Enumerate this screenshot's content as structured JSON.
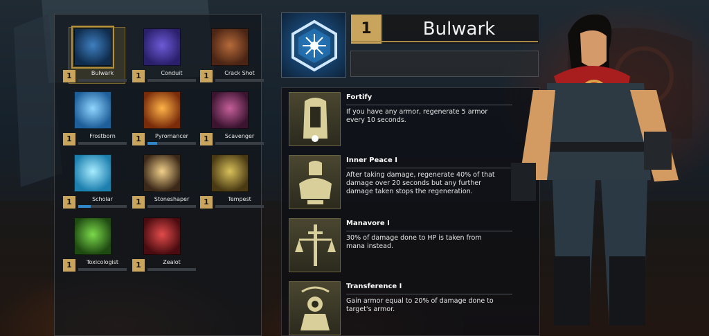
{
  "classes": [
    {
      "name": "Bulwark",
      "level": "1",
      "xp": 0,
      "selected": true,
      "icon": "shield-icon"
    },
    {
      "name": "Conduit",
      "level": "1",
      "xp": 0,
      "icon": "lightning-icon"
    },
    {
      "name": "Crack Shot",
      "level": "1",
      "xp": 0,
      "icon": "crosshair-icon"
    },
    {
      "name": "Frostborn",
      "level": "1",
      "xp": 0,
      "icon": "ice-crystal-icon"
    },
    {
      "name": "Pyromancer",
      "level": "1",
      "xp": 0.2,
      "icon": "flame-icon"
    },
    {
      "name": "Scavenger",
      "level": "1",
      "xp": 0,
      "icon": "pot-icon"
    },
    {
      "name": "Scholar",
      "level": "1",
      "xp": 0.25,
      "icon": "book-icon"
    },
    {
      "name": "Stoneshaper",
      "level": "1",
      "xp": 0,
      "icon": "rock-icon"
    },
    {
      "name": "Tempest",
      "level": "1",
      "xp": 0,
      "icon": "whirlwind-icon"
    },
    {
      "name": "Toxicologist",
      "level": "1",
      "xp": 0,
      "icon": "toxic-ring-icon"
    },
    {
      "name": "Zealot",
      "level": "1",
      "xp": 0,
      "icon": "blade-icon"
    }
  ],
  "selected_class": {
    "name": "Bulwark",
    "level": "1"
  },
  "perks": [
    {
      "title": "Fortify",
      "description": "If you have any armor, regenerate 5 armor\nevery 10 seconds.",
      "icon": "knight-helmet-icon"
    },
    {
      "title": "Inner Peace I",
      "description": "After taking damage, regenerate 40% of that\ndamage over 20 seconds but any further\ndamage taken stops the regeneration.",
      "icon": "meditating-knight-icon"
    },
    {
      "title": "Manavore I",
      "description": "30% of damage done to HP is taken from\nmana instead.",
      "icon": "scales-sword-icon"
    },
    {
      "title": "Transference   I",
      "description": "Gain armor equal to 20% of damage done to\ntarget's armor.",
      "icon": "figure-arrows-icon"
    }
  ],
  "colors": {
    "gold": "#c9a45c",
    "xp_blue": "#2f86c8",
    "panel": "#12161c"
  }
}
